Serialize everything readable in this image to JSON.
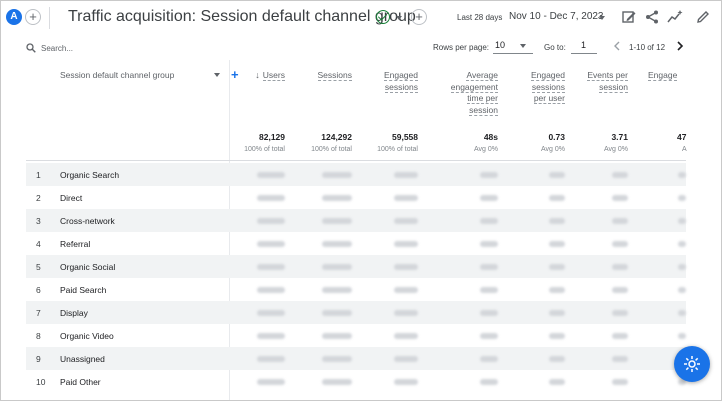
{
  "header": {
    "avatar_letter": "A",
    "title": "Traffic acquisition: Session default channel group",
    "date_label": "Last 28 days",
    "date_range": "Nov 10 - Dec 7, 2023"
  },
  "controls": {
    "search_placeholder": "Search...",
    "rows_per_page_label": "Rows per page:",
    "rows_per_page_value": "10",
    "goto_label": "Go to:",
    "goto_value": "1",
    "pagination": "1-10 of 12"
  },
  "table": {
    "dimension_header": "Session default channel group",
    "columns": [
      {
        "label": "Users",
        "total": "82,129",
        "sub": "100% of total"
      },
      {
        "label": "Sessions",
        "total": "124,292",
        "sub": "100% of total"
      },
      {
        "label": "Engaged sessions",
        "total": "59,558",
        "sub": "100% of total"
      },
      {
        "label": "Average engagement time per session",
        "total": "48s",
        "sub": "Avg 0%"
      },
      {
        "label": "Engaged sessions per user",
        "total": "0.73",
        "sub": "Avg 0%"
      },
      {
        "label": "Events per session",
        "total": "3.71",
        "sub": "Avg 0%"
      },
      {
        "label": "Engage",
        "total": "47",
        "sub": "A"
      }
    ],
    "rows": [
      {
        "index": "1",
        "name": "Organic Search"
      },
      {
        "index": "2",
        "name": "Direct"
      },
      {
        "index": "3",
        "name": "Cross-network"
      },
      {
        "index": "4",
        "name": "Referral"
      },
      {
        "index": "5",
        "name": "Organic Social"
      },
      {
        "index": "6",
        "name": "Paid Search"
      },
      {
        "index": "7",
        "name": "Display"
      },
      {
        "index": "8",
        "name": "Organic Video"
      },
      {
        "index": "9",
        "name": "Unassigned"
      },
      {
        "index": "10",
        "name": "Paid Other"
      }
    ]
  },
  "icons": {
    "add_comparison": "plus-icon",
    "status": "check-circle-icon",
    "edit_report": "edit-report-icon",
    "share": "share-icon",
    "insights": "insights-icon",
    "pencil": "pencil-icon",
    "search": "search-icon",
    "fab": "assistant-icon"
  },
  "colors": {
    "accent": "#1a73e8",
    "check": "#188038",
    "row_alt": "#f1f3f4"
  }
}
